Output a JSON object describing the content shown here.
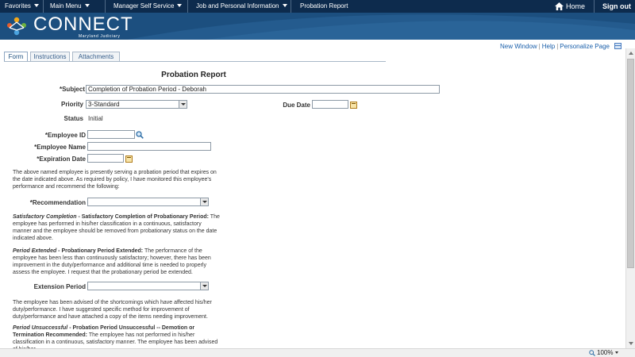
{
  "topnav": {
    "favorites": "Favorites",
    "main_menu": "Main Menu",
    "manager_self_service": "Manager Self Service",
    "job_personal": "Job and Personal Information",
    "current": "Probation Report",
    "home": "Home",
    "sign_out": "Sign out"
  },
  "banner": {
    "brand": "CONNECT",
    "sub": "Maryland Judiciary"
  },
  "pagelinks": {
    "new_window": "New Window",
    "help": "Help",
    "personalize": "Personalize Page"
  },
  "tabs": [
    "Form",
    "Instructions",
    "Attachments"
  ],
  "form": {
    "title": "Probation Report",
    "subject_label": "*Subject",
    "subject_value": "Completion of Probation Period - Deborah",
    "priority_label": "Priority",
    "priority_value": "3-Standard",
    "due_date_label": "Due Date",
    "due_date_value": "",
    "status_label": "Status",
    "status_value": "Initial",
    "employee_id_label": "*Employee ID",
    "employee_id_value": "",
    "employee_name_label": "*Employee Name",
    "employee_name_value": "",
    "expiration_label": "*Expiration Date",
    "expiration_value": "",
    "intro": "The above named employee is presently serving a probation period that expires on the date indicated above. As required by policy, I have monitored this employee's performance and recommend the following:",
    "recommendation_label": "*Recommendation",
    "recommendation_value": "",
    "sat_title_italic": "Satisfactory Completion",
    "sat_title_bold": " - Satisfactory Completion of Probationary Period:",
    "sat_text": " The employee has performed in his/her classification in a continuous, satisfactory manner and the employee should be removed from probationary status on the date indicated above.",
    "ext_title_italic": "Period Extended",
    "ext_title_bold": " - Probationary Period Extended:",
    "ext_text": " The performance of the employee has been less than continuously satisfactory; however, there has been improvement in the duty/performance and additional time is needed to properly assess the employee. I request that the probationary period be extended.",
    "extension_label": "Extension Period",
    "extension_value": "",
    "advised_text": "The employee has been advised of the shortcomings which have affected his/her duty/performance. I have suggested specific method for improvement of duty/performance and have attached a copy of the items needing improvement.",
    "uns_title_italic": "Period Unsuccessful",
    "uns_title_bold": " - Probation Period Unsuccessful -- Demotion or Termination Recommended:",
    "uns_text": " The employee has not performed in his/her classification in a continuous, satisfactory manner. The employee has been advised of his/her"
  },
  "status": {
    "zoom": "100%"
  },
  "colors": {
    "topnav": "#0d2b4d",
    "banner": "#1c4f7f",
    "link": "#1a5faa"
  }
}
